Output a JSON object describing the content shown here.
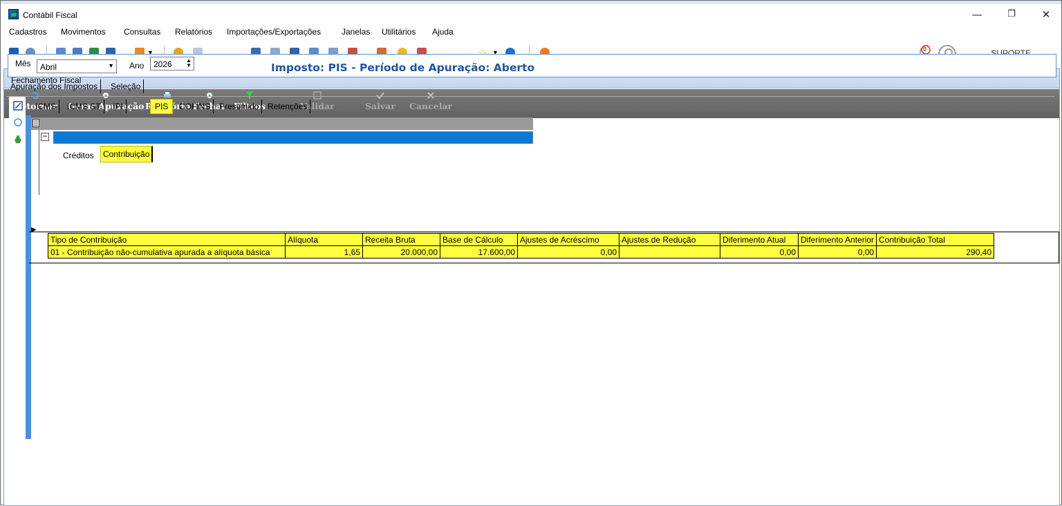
{
  "window": {
    "title": "Contábil Fiscal",
    "buttons": {
      "minimize": "—",
      "restore": "❐",
      "close": "✕"
    }
  },
  "menu": [
    "Cadastros",
    "Movimentos",
    "Consultas",
    "Relatórios",
    "Importações/Exportações",
    "Janelas",
    "Utilitários",
    "Ajuda"
  ],
  "toolbar": {
    "notification_count": "0",
    "user_label": "SUPORTE"
  },
  "child_window": {
    "title": "Fechamento Fiscal",
    "actions": [
      {
        "label": "Retornar",
        "enabled": true
      },
      {
        "label": "Gerar Apuração",
        "enabled": true
      },
      {
        "label": "Relatório",
        "enabled": true
      },
      {
        "label": "Fechar",
        "enabled": true
      },
      {
        "label": "Filtros",
        "enabled": true
      },
      {
        "label": "Validar",
        "enabled": false
      },
      {
        "label": "Salvar",
        "enabled": false
      },
      {
        "label": "Cancelar",
        "enabled": false
      }
    ]
  },
  "filters": {
    "mes_label": "Mês",
    "mes_value": "Abril",
    "ano_label": "Ano",
    "ano_value": "2026",
    "imposto_heading": "Imposto: PIS - Período de Apuração: Aberto"
  },
  "main_tabs": [
    "Apuração dos Impostos",
    "Seleção"
  ],
  "tax_tabs": [
    "ICMS",
    "ICMS ST",
    "IPI",
    "PIS",
    "COFINS",
    "Presumido",
    "Retenções"
  ],
  "active_tax_tab": "PIS",
  "detail_tabs": [
    "Créditos",
    "Contribuição"
  ],
  "active_detail_tab": "Contribuição",
  "table": {
    "columns": [
      "Tipo de Contribuição",
      "Alíquota",
      "Receita Bruta",
      "Base de Cálculo",
      "Ajustes de Acréscimo",
      "Ajustes de Redução",
      "Diferimento Atual",
      "Diferimento Anterior",
      "Contribuição Total"
    ],
    "rows": [
      [
        "01 - Contribuição não-cumulativa apurada a alíquota básica",
        "1,65",
        "20.000,00",
        "17.600,00",
        "0,00",
        "",
        "0,00",
        "0,00",
        "290,40"
      ]
    ]
  },
  "colors": {
    "highlight": "#ffff40",
    "heading_blue": "#1f55a3",
    "selected_row": "#0a78d6",
    "action_bar": "#6e6e6e"
  }
}
